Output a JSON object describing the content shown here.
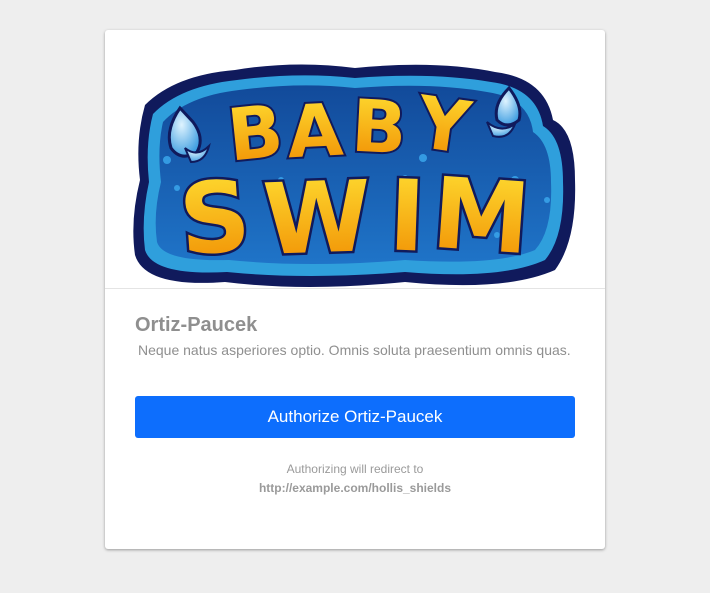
{
  "logo": {
    "icon": "baby-swim-logo",
    "line1": "BABY",
    "line2": "SWIM",
    "colors": {
      "outline": "#101a5c",
      "inner_blue": "#1a5fb4",
      "ring_blue": "#2f9fdc",
      "letter_top": "#ffd21a",
      "letter_bottom": "#f08a00",
      "drop": "#6ec6f5"
    }
  },
  "app": {
    "name": "Ortiz-Paucek",
    "description": "Neque natus asperiores optio. Omnis soluta praesentium omnis quas."
  },
  "authorize": {
    "label": "Authorize Ortiz-Paucek",
    "color": "#0d6efd"
  },
  "redirect": {
    "note": "Authorizing will redirect to",
    "url": "http://example.com/hollis_shields"
  }
}
